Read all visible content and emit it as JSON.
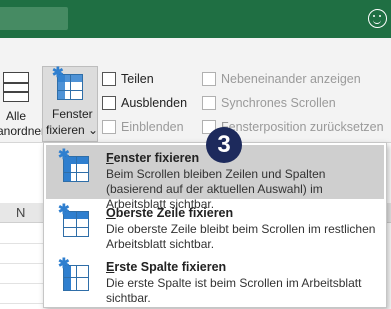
{
  "ribbon": {
    "alle_label": "Alle",
    "anordnen_label": "anordnen",
    "fenster_label": "Fenster",
    "fixieren_label": "fixieren",
    "teilen": "Teilen",
    "ausblenden": "Ausblenden",
    "einblenden": "Einblenden",
    "nebeneinander": "Nebeneinander anzeigen",
    "synchron": "Synchrones Scrollen",
    "fensterposition": "Fensterposition zurücksetzen"
  },
  "sheet": {
    "column_n": "N"
  },
  "badge": "3",
  "menu": {
    "items": [
      {
        "title": "Fenster fixieren",
        "desc": "Beim Scrollen bleiben Zeilen und Spalten (basierend auf der aktuellen Auswahl) im Arbeitsblatt sichtbar."
      },
      {
        "title": "Oberste Zeile fixieren",
        "desc": "Die oberste Zeile bleibt beim Scrollen im restlichen Arbeitsblatt sichtbar."
      },
      {
        "title": "Erste Spalte fixieren",
        "desc": "Die erste Spalte ist beim Scrollen im Arbeitsblatt sichtbar."
      }
    ]
  },
  "colors": {
    "title_bar": "#1f6f43",
    "accent_blue": "#2f7fcf",
    "badge_bg": "#1d2a5c"
  }
}
